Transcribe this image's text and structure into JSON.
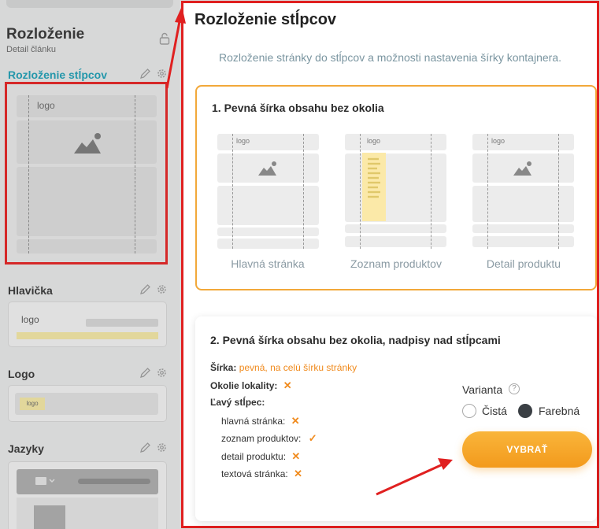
{
  "sidebar": {
    "title": "Rozloženie",
    "subtitle": "Detail článku",
    "sections": [
      {
        "title": "Rozloženie stĺpcov",
        "logo_text": "logo"
      },
      {
        "title": "Hlavička",
        "logo_text": "logo"
      },
      {
        "title": "Logo",
        "logo_text": "logo"
      },
      {
        "title": "Jazyky"
      }
    ]
  },
  "modal": {
    "title": "Rozloženie stĺpcov",
    "subtitle": "Rozloženie stránky do stĺpcov a možnosti nastavenia šírky kontajnera.",
    "option1": {
      "title": "1. Pevná šírka obsahu bez okolia",
      "thumbs": [
        {
          "label": "Hlavná stránka",
          "logo": "logo"
        },
        {
          "label": "Zoznam produktov",
          "logo": "logo"
        },
        {
          "label": "Detail produktu",
          "logo": "logo"
        }
      ]
    },
    "option2": {
      "title": "2. Pevná šírka obsahu bez okolia, nadpisy nad stĺpcami",
      "width_label": "Šírka:",
      "width_value": "pevná, na celú šírku stránky",
      "surroundings_label": "Okolie lokality:",
      "left_column_label": "Ľavý stĺpec:",
      "left_column_items": [
        {
          "label": "hlavná stránka:",
          "mark": "✕"
        },
        {
          "label": "zoznam produktov:",
          "mark": "✓"
        },
        {
          "label": "detail produktu:",
          "mark": "✕"
        },
        {
          "label": "textová stránka:",
          "mark": "✕"
        }
      ],
      "x_mark": "✕",
      "variant_label": "Varianta",
      "help": "?",
      "variant_clean": "Čistá",
      "variant_color": "Farebná",
      "button": "VYBRAŤ"
    }
  },
  "colors": {
    "accent": "#f39a1c",
    "highlight": "#e02020",
    "teal": "#1b9bb1"
  }
}
